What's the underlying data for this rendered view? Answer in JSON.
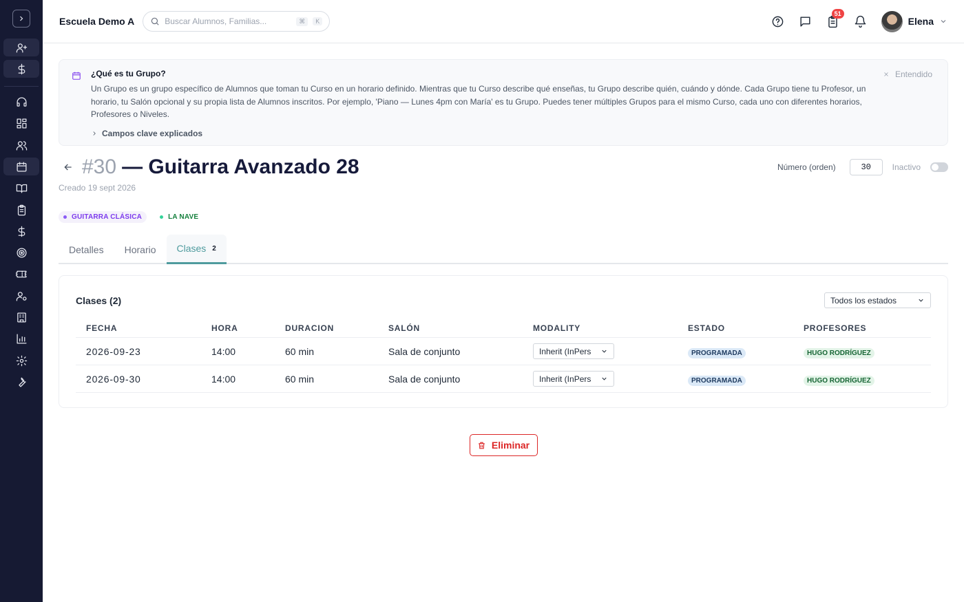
{
  "sidebar": {
    "icons": [
      "add-user-icon",
      "dollar-icon",
      "headset-icon",
      "dashboard-icon",
      "users-icon",
      "calendar-icon",
      "book-icon",
      "clipboard-icon",
      "dollar-icon",
      "target-icon",
      "ticket-icon",
      "user-gear-icon",
      "building-icon",
      "chart-icon",
      "settings-icon",
      "wrench-icon"
    ]
  },
  "topbar": {
    "school_name": "Escuela Demo A",
    "search_placeholder": "Buscar Alumnos, Familias...",
    "shortcut_key1": "⌘",
    "shortcut_key2": "K",
    "tasks_badge": "51",
    "user_name": "Elena"
  },
  "info": {
    "title": "¿Qué es tu Grupo?",
    "text": "Un Grupo es un grupo específico de Alumnos que toman tu Curso en un horario definido. Mientras que tu Curso describe qué enseñas, tu Grupo describe quién, cuándo y dónde. Cada Grupo tiene tu Profesor, un horario, tu Salón opcional y su propia lista de Alumnos inscritos. Por ejemplo, 'Piano — Lunes 4pm con María' es tu Grupo. Puedes tener múltiples Grupos para el mismo Curso, cada uno con diferentes horarios, Profesores o Niveles.",
    "more_label": "Campos clave explicados",
    "dismiss_label": "Entendido"
  },
  "group": {
    "number": "#30",
    "title": "— Guitarra Avanzado 28",
    "created": "Creado 19 sept 2026",
    "order_label": "Número (orden)",
    "order_value": "30",
    "inactive_label": "Inactivo",
    "tags": [
      "GUITARRA CLÁSICA",
      "LA NAVE"
    ]
  },
  "tabs": [
    {
      "label": "Detalles"
    },
    {
      "label": "Horario"
    },
    {
      "label": "Clases",
      "count": "2"
    }
  ],
  "classes": {
    "title": "Clases (2)",
    "filter_value": "Todos los estados",
    "columns": [
      "FECHA",
      "HORA",
      "DURACION",
      "SALÓN",
      "MODALITY",
      "ESTADO",
      "PROFESORES"
    ],
    "rows": [
      {
        "date": "2026-09-23",
        "time": "14:00",
        "duration": "60 min",
        "room": "Sala de conjunto",
        "modality": "Inherit (InPers",
        "status": "PROGRAMADA",
        "teacher": "HUGO RODRÍGUEZ"
      },
      {
        "date": "2026-09-30",
        "time": "14:00",
        "duration": "60 min",
        "room": "Sala de conjunto",
        "modality": "Inherit (InPers",
        "status": "PROGRAMADA",
        "teacher": "HUGO RODRÍGUEZ"
      }
    ]
  },
  "actions": {
    "delete_label": "Eliminar"
  },
  "colors": {
    "sidebar_bg": "#161a33",
    "accent_teal": "#4f9b9e",
    "danger": "#dc2626",
    "badge_red": "#ef4444"
  }
}
